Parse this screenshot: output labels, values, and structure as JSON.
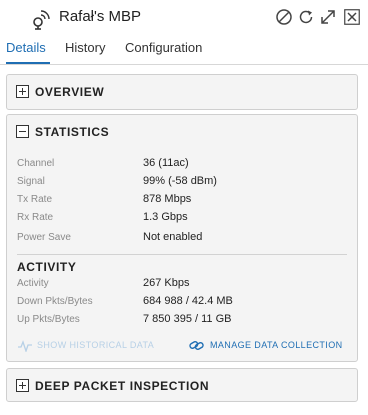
{
  "header": {
    "title": "Rafał's MBP",
    "device_icon": "wireless-client-icon",
    "buttons": [
      "block-icon",
      "refresh-icon",
      "expand-icon",
      "close-icon"
    ]
  },
  "tabs": [
    {
      "label": "Details",
      "active": true
    },
    {
      "label": "History",
      "active": false
    },
    {
      "label": "Configuration",
      "active": false
    }
  ],
  "overview": {
    "title": "OVERVIEW",
    "expanded": false
  },
  "statistics": {
    "title": "STATISTICS",
    "expanded": true,
    "rows": [
      {
        "label": "Channel",
        "value": "36 (11ac)"
      },
      {
        "label": "Signal",
        "value": "99% (-58 dBm)"
      },
      {
        "label": "Tx Rate",
        "value": "878 Mbps"
      },
      {
        "label": "Rx Rate",
        "value": "1.3 Gbps"
      },
      {
        "label": "Power Save",
        "value": "Not enabled"
      }
    ],
    "activity_title": "ACTIVITY",
    "activity_rows": [
      {
        "label": "Activity",
        "value": "267 Kbps"
      },
      {
        "label": "Down Pkts/Bytes",
        "value": "684 988 / 42.4 MB"
      },
      {
        "label": "Up Pkts/Bytes",
        "value": "7 850 395 / 11 GB"
      }
    ],
    "show_historical_label": "SHOW HISTORICAL DATA",
    "manage_collection_label": "MANAGE DATA COLLECTION"
  },
  "dpi": {
    "title": "DEEP PACKET INSPECTION",
    "expanded": false
  },
  "colors": {
    "accent": "#1f6eb3",
    "disabled_link": "#b7d0e6",
    "panel_bg": "#f4f4f4"
  }
}
